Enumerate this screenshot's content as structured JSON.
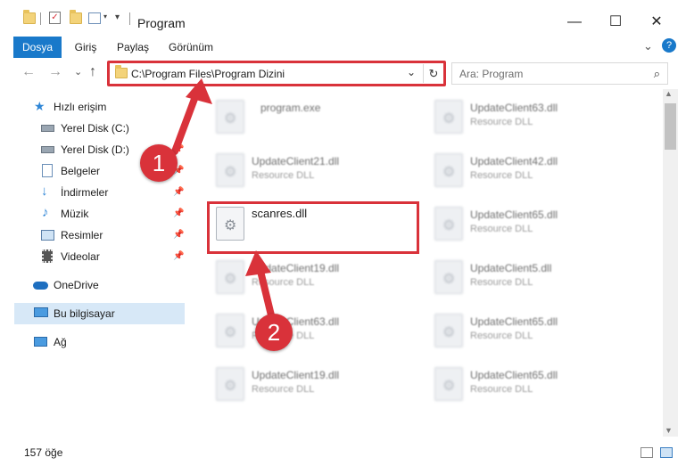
{
  "window": {
    "title": "Program",
    "minimize": "—",
    "maximize": "☐",
    "close": "✕"
  },
  "ribbon": {
    "tabs": [
      "Dosya",
      "Giriş",
      "Paylaş",
      "Görünüm"
    ],
    "collapse": "⌄",
    "help": "?"
  },
  "nav": {
    "back": "←",
    "forward": "→",
    "recent": "⌄",
    "up": "↑",
    "address": "C:\\Program Files\\Program Dizini",
    "dropdown": "⌄",
    "refresh": "↻",
    "search_placeholder": "Ara: Program",
    "search_icon": "⌕"
  },
  "sidebar": {
    "items": [
      {
        "label": "Hızlı erişim",
        "icon": "star-icon"
      },
      {
        "label": "Yerel Disk (C:)",
        "icon": "drive-icon"
      },
      {
        "label": "Yerel Disk (D:)",
        "icon": "drive-icon"
      },
      {
        "label": "Belgeler",
        "icon": "documents-icon"
      },
      {
        "label": "İndirmeler",
        "icon": "download-icon"
      },
      {
        "label": "Müzik",
        "icon": "music-icon"
      },
      {
        "label": "Resimler",
        "icon": "pictures-icon"
      },
      {
        "label": "Videolar",
        "icon": "videos-icon"
      },
      {
        "label": "OneDrive",
        "icon": "cloud-icon"
      },
      {
        "label": "Bu bilgisayar",
        "icon": "computer-icon"
      },
      {
        "label": "Ağ",
        "icon": "network-icon"
      }
    ],
    "pin": "📌"
  },
  "files": [
    {
      "name": "program.exe",
      "type": ""
    },
    {
      "name": "UpdateClient63.dll",
      "type": "Resource DLL"
    },
    {
      "name": "UpdateClient21.dll",
      "type": "Resource DLL"
    },
    {
      "name": "UpdateClient42.dll",
      "type": "Resource DLL"
    },
    {
      "name": "scanres.dll",
      "type": ""
    },
    {
      "name": "UpdateClient65.dll",
      "type": "Resource DLL"
    },
    {
      "name": "UpdateClient19.dll",
      "type": "Resource DLL"
    },
    {
      "name": "UpdateClient5.dll",
      "type": "Resource DLL"
    },
    {
      "name": "UpdateClient63.dll",
      "type": "Resource DLL"
    },
    {
      "name": "UpdateClient65.dll",
      "type": "Resource DLL"
    },
    {
      "name": "UpdateClient19.dll",
      "type": "Resource DLL"
    },
    {
      "name": "UpdateClient65.dll",
      "type": "Resource DLL"
    }
  ],
  "status": {
    "count": "157 öğe"
  },
  "annotations": {
    "step1": "1",
    "step2": "2",
    "color": "#d9323a"
  }
}
